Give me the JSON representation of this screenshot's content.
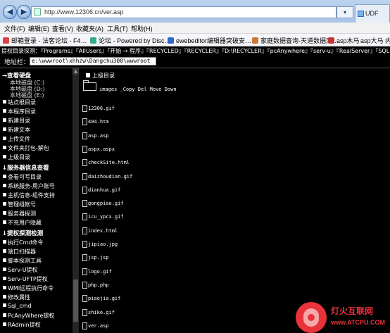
{
  "browser": {
    "url": "http://www.12306.cn/ver.asp",
    "tab_title": "UDF作…",
    "tools_label": "▾"
  },
  "menubar": {
    "items": [
      "文件(F)",
      "编辑(E)",
      "查看(V)",
      "收藏夹(A)",
      "工具(T)",
      "帮助(H)"
    ]
  },
  "favorites": {
    "items": [
      {
        "label": "邮箱登录 - 法客论坛 - F4…",
        "color": "#d44"
      },
      {
        "label": "论坛 - Powered by Disc…",
        "color": "#3a8"
      },
      {
        "label": "ewebeditor编辑器突破安…",
        "color": "#36c"
      },
      {
        "label": "家庭数据查询-天道数据库…",
        "color": "#c73"
      },
      {
        "label": "asp木马",
        "color": "#c33"
      },
      {
        "label": "asp大马 内置…",
        "color": "#c33"
      }
    ]
  },
  "shell": {
    "path_bar": "提权目录探测：『Programs』『AllUsers』『开始 → 程序』『RECYCLED』『RECYCLER』『D:\\RECYCLER』『pcAnywhere』『serv-u』『RealServer』『SQL 』『config』",
    "address_label": "地址栏：",
    "address_value": "e:\\wwwroot\\xhhzw\\Dangchu300\\wwwroot"
  },
  "sidebar": {
    "view_disk_header": "→查看硬盘",
    "drives": [
      "本地磁盘 (C:)",
      "本地磁盘 (D:)",
      "本地磁盘 (E:)"
    ],
    "tools": [
      "站点根目录",
      "本程序目录",
      "新建目录",
      "新建文本",
      "上传文件",
      "文件夹打包-解包",
      "上级目录"
    ],
    "server_header": "↓服务器信息查看",
    "server_items": [
      "查看可写目录",
      "系统服务-用户账号",
      "主机信息-组件支持",
      "管理组帐号",
      "服务器探测",
      "不充用户隐藏"
    ],
    "privilege_header": "↓提权探测检测",
    "privilege_items": [
      "执行Cmd命令",
      "端口扫描器",
      "脚本探测工具",
      "Serv-U提权",
      "Serv-UFTP提权",
      "WMI远程执行命令",
      "修改属性",
      "Sql_cmd",
      "PcAnyWhere提权",
      "RAdmin提权"
    ]
  },
  "listing": {
    "parent_label": "上级目录",
    "folder_name": "images  _Copy Del Move Down",
    "files": [
      "12306.gif",
      "404.htm",
      "asp.asp",
      "aspx.aspx",
      "checkSite.html",
      "daizhoudian.gif",
      "dianhua.gif",
      "gongpiao.gif",
      "icu_ypcx.gif",
      "index.html",
      "jipiao.jpg",
      "jsp.jsp",
      "logo.gif",
      "php.php",
      "piaojia.gif",
      "shike.gif",
      "ver.asp"
    ]
  },
  "watermark": {
    "text_cn": "灯火互联网",
    "text_en": "www.ATCPU.COM"
  }
}
